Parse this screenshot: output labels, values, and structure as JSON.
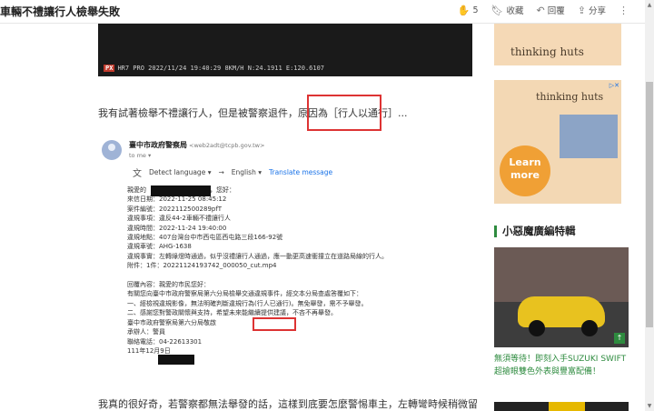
{
  "header": {
    "title": "車輛不禮讓行人檢舉失敗",
    "like_count": "5",
    "save_label": "收藏",
    "reply_label": "回覆",
    "share_label": "分享"
  },
  "article": {
    "video_stamp_badge": "PX",
    "video_stamp": "HR7 PRO 2022/11/24 19:40:29 8KM/H N:24.1911 E:120.6107",
    "paragraph1": "我有試著檢舉不禮讓行人，但是被警察退件，原因為［行人以通行］...",
    "paragraph2": "我真的很好奇，若警察都無法舉發的話，這樣到底要怎麼警惕車主，左轉彎時候稍微留意一下有沒有人要過馬路，真的不需要搶快..."
  },
  "email": {
    "sender": "臺中市政府警察局",
    "sender_address": "<web2adt@tcpb.gov.tw>",
    "to": "to me ▾",
    "detect_language": "Detect language ▾",
    "english": "English ▾",
    "translate_link": "Translate message",
    "lines": [
      "親愛的",
      "來信日期：2022-11-25 08:45:12",
      "案件編號：2022112500289pfT",
      "違規事項：違反44-2車輛不禮讓行人",
      "違規時間：2022-11-24 19:40:00",
      "違規地點：407台灣台中市西屯區西屯路三段166-92號",
      "違規車號：AHG-1638",
      "違規事實：左轉綠燈時通過，似乎沒禮讓行人通過，應一動更高速衝撞立在道路局線的行人。",
      "附件：1件：20221124193742_000050_cut.mp4",
      "",
      "回覆內容：親愛的市民您好：",
      "有關您向臺中市政府警察局第六分局檢舉交通違規事件，經交本分局查處答覆如下：",
      "一、經檢視違規影像，無法明確判斷違規行為(行人已通行)。無免舉發，需不予舉發。",
      "二、感謝您對警政關懷與支持，希望未來能繼續提供建議，不吝不再舉發。",
      "臺中市政府警察局第六分局敬啟",
      "承辦人：警員",
      "聯絡電話：04-22613301",
      "111年12月9日"
    ],
    "greeting_suffix": "，您好："
  },
  "sidebar": {
    "ad1_text": "thinking huts",
    "ad2_text": "thinking huts",
    "ad2_learn": "Learn more",
    "section_title": "小惡魔廣編特輯",
    "car_caption": "無須等待！即刻入手SUZUKI SWIFT超搶眼雙色外表與豐富配備！",
    "up_arrow": "↑"
  }
}
